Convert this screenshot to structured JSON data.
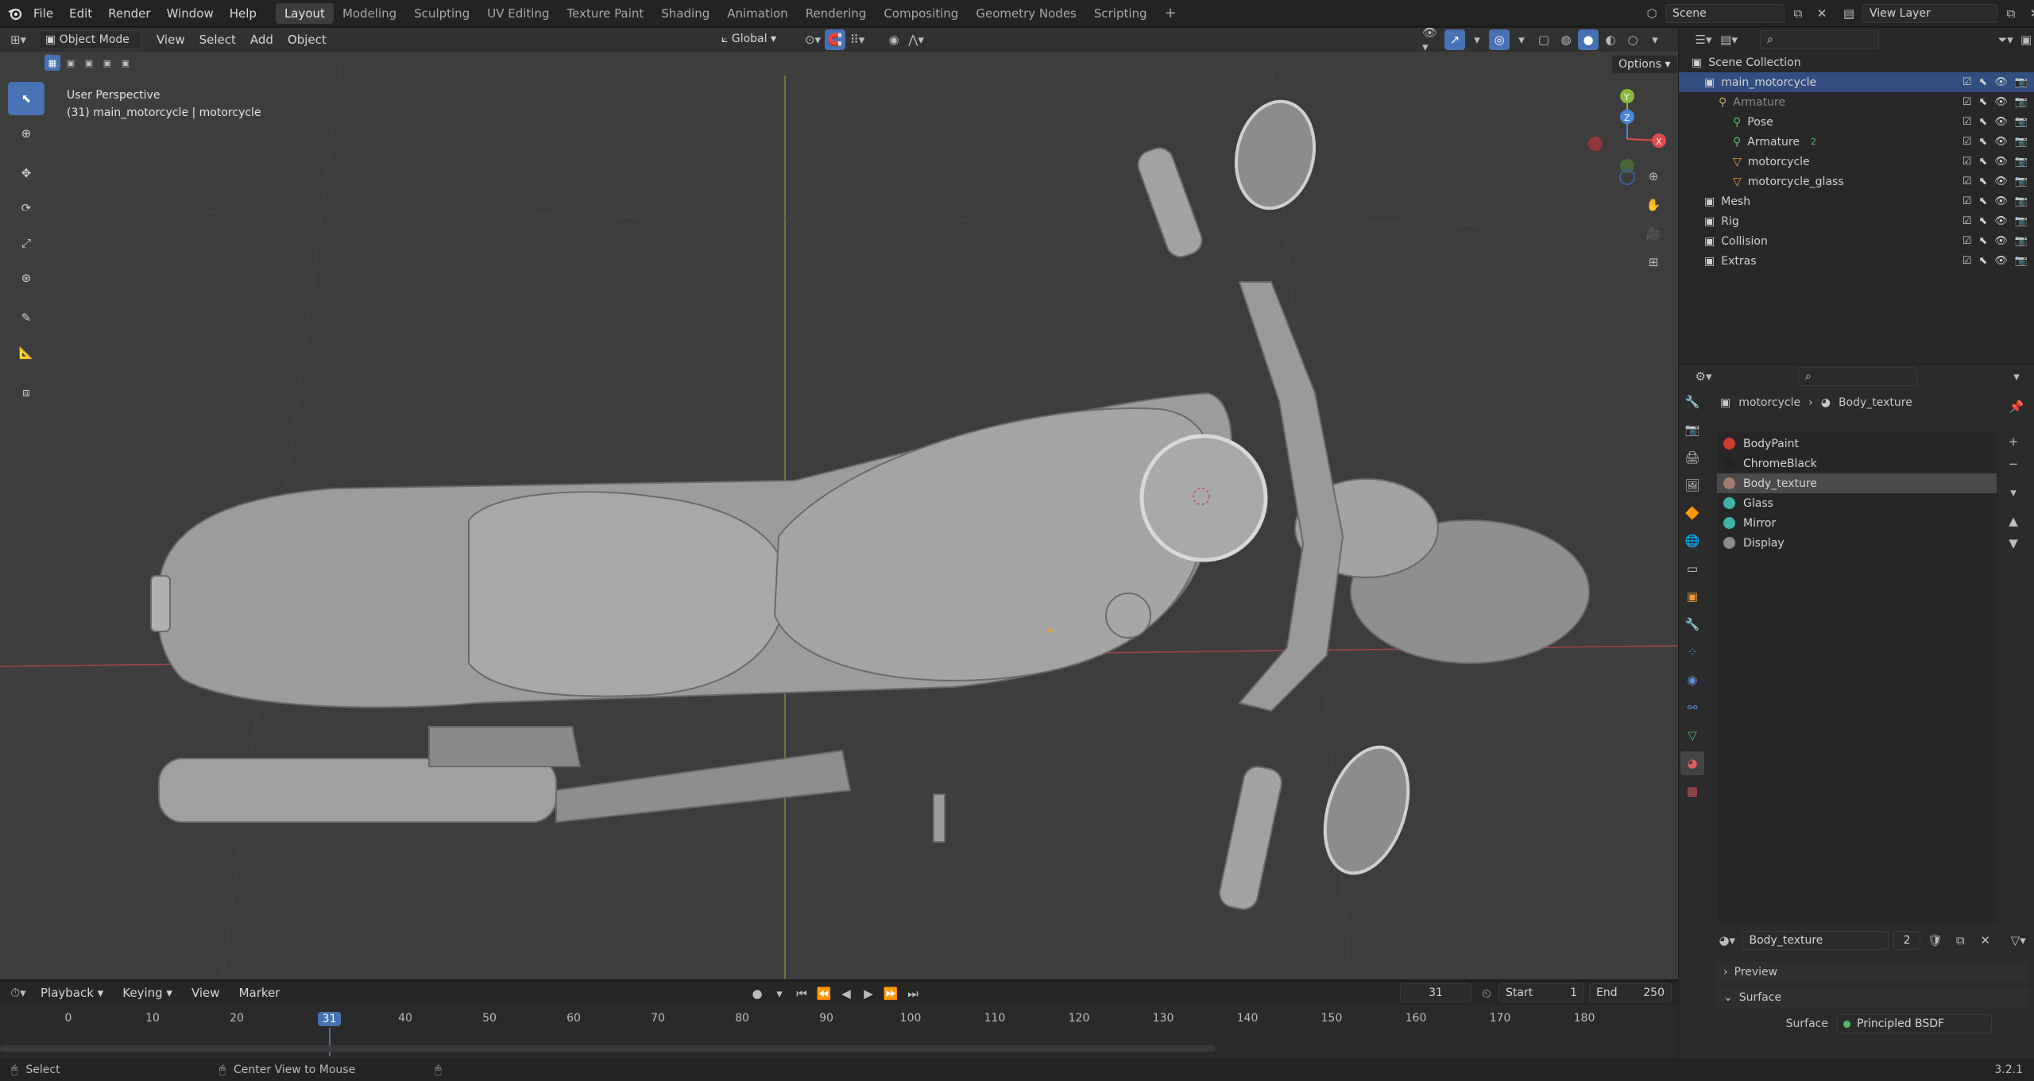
{
  "topbar": {
    "menus": [
      "File",
      "Edit",
      "Render",
      "Window",
      "Help"
    ],
    "workspaces": [
      "Layout",
      "Modeling",
      "Sculpting",
      "UV Editing",
      "Texture Paint",
      "Shading",
      "Animation",
      "Rendering",
      "Compositing",
      "Geometry Nodes",
      "Scripting"
    ],
    "active_workspace": "Layout",
    "add_tab": "+",
    "scene": "Scene",
    "view_layer": "View Layer"
  },
  "viewport": {
    "mode": "Object Mode",
    "menus": [
      "View",
      "Select",
      "Add",
      "Object"
    ],
    "orientation": "Global",
    "options_label": "Options",
    "overlay_line1": "User Perspective",
    "overlay_line2": "(31) main_motorcycle | motorcycle",
    "gizmo": {
      "x": "X",
      "y": "Y",
      "z": "Z"
    }
  },
  "outliner": {
    "root": "Scene Collection",
    "rows": [
      {
        "label": "main_motorcycle",
        "indent": 1,
        "kind": "collection",
        "selected": true
      },
      {
        "label": "Armature",
        "indent": 2,
        "kind": "armature",
        "muted": true
      },
      {
        "label": "Pose",
        "indent": 3,
        "kind": "pose"
      },
      {
        "label": "Armature",
        "indent": 3,
        "kind": "armature-data",
        "badge": "2"
      },
      {
        "label": "motorcycle",
        "indent": 3,
        "kind": "mesh"
      },
      {
        "label": "motorcycle_glass",
        "indent": 3,
        "kind": "mesh"
      },
      {
        "label": "Mesh",
        "indent": 1,
        "kind": "collection"
      },
      {
        "label": "Rig",
        "indent": 1,
        "kind": "collection"
      },
      {
        "label": "Collision",
        "indent": 1,
        "kind": "collection"
      },
      {
        "label": "Extras",
        "indent": 1,
        "kind": "collection"
      }
    ]
  },
  "properties": {
    "breadcrumb_object": "motorcycle",
    "breadcrumb_material": "Body_texture",
    "materials": [
      {
        "label": "BodyPaint",
        "color": "#d23a2f"
      },
      {
        "label": "ChromeBlack",
        "color": "#222222"
      },
      {
        "label": "Body_texture",
        "color": "#a07a6a",
        "selected": true
      },
      {
        "label": "Glass",
        "color": "#3fb3a8"
      },
      {
        "label": "Mirror",
        "color": "#3fb3a8"
      },
      {
        "label": "Display",
        "color": "#8a8a8a"
      }
    ],
    "material_name": "Body_texture",
    "user_count": "2",
    "preview_label": "Preview",
    "surface_section": "Surface",
    "surface_label": "Surface",
    "surface_value": "Principled BSDF"
  },
  "timeline": {
    "menus": [
      "Playback",
      "Keying",
      "View",
      "Marker"
    ],
    "current_frame": "31",
    "start_label": "Start",
    "start_value": "1",
    "end_label": "End",
    "end_value": "250",
    "ticks": [
      "0",
      "10",
      "20",
      "31",
      "40",
      "50",
      "60",
      "70",
      "80",
      "90",
      "100",
      "110",
      "120",
      "130",
      "140",
      "150",
      "160",
      "170",
      "180"
    ]
  },
  "statusbar": {
    "select": "Select",
    "center": "Center View to Mouse",
    "version": "3.2.1"
  },
  "colors": {
    "accent": "#4772b3",
    "selected_row": "#334d80",
    "x_axis": "#e34b4b",
    "y_axis": "#8ab93f",
    "z_axis": "#4a86e0"
  }
}
